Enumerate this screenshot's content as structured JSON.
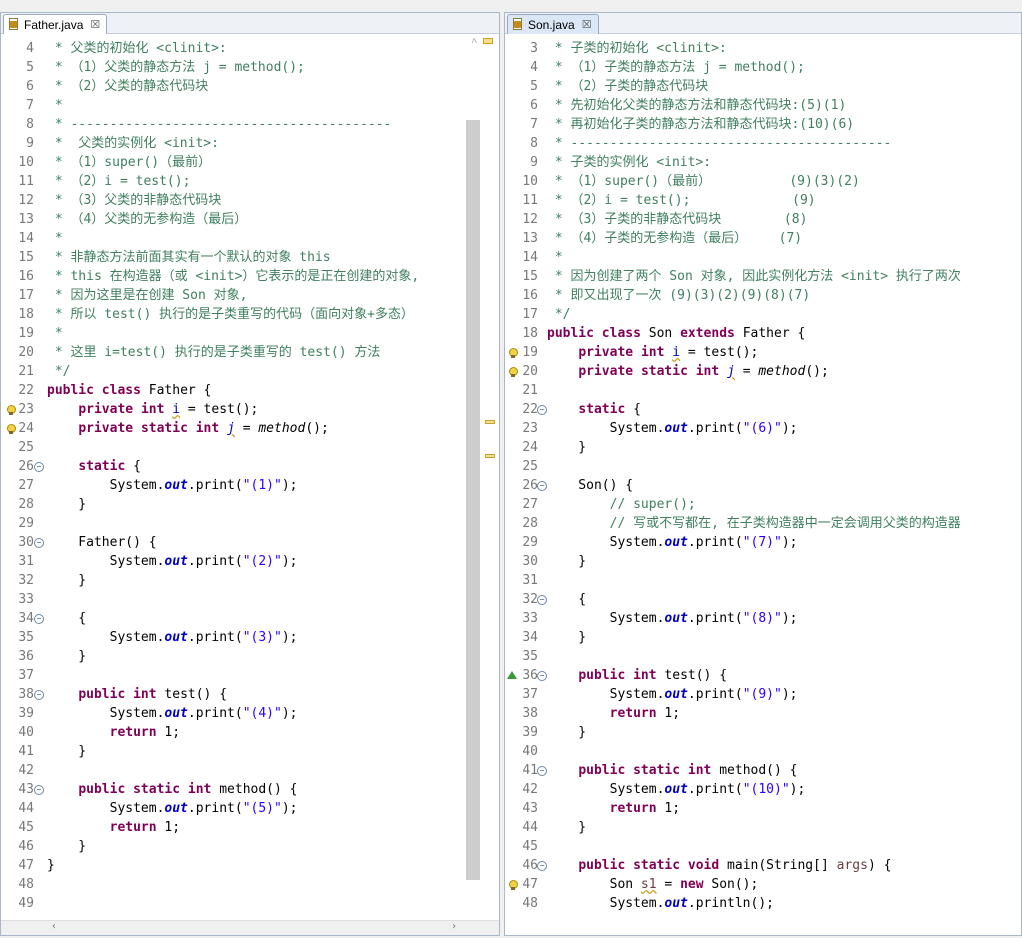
{
  "left": {
    "tab_label": "Father.java",
    "close_glyph": "☒",
    "lines": [
      {
        "n": "4",
        "html": "<span class='cmt'> * 父类的初始化 &lt;clinit&gt;:</span>"
      },
      {
        "n": "5",
        "html": "<span class='cmt'> * （1）父类的静态方法 j = method();</span>"
      },
      {
        "n": "6",
        "html": "<span class='cmt'> * （2）父类的静态代码块</span>"
      },
      {
        "n": "7",
        "html": "<span class='cmt'> *</span>"
      },
      {
        "n": "8",
        "html": "<span class='cmt'> * -----------------------------------------</span>"
      },
      {
        "n": "9",
        "html": "<span class='cmt'> *  父类的实例化 &lt;init&gt;:</span>"
      },
      {
        "n": "10",
        "html": "<span class='cmt'> * （1）super()（最前）</span>"
      },
      {
        "n": "11",
        "html": "<span class='cmt'> * （2）i = test();</span>"
      },
      {
        "n": "12",
        "html": "<span class='cmt'> * （3）父类的非静态代码块</span>"
      },
      {
        "n": "13",
        "html": "<span class='cmt'> * （4）父类的无参构造（最后）</span>"
      },
      {
        "n": "14",
        "html": "<span class='cmt'> *</span>"
      },
      {
        "n": "15",
        "html": "<span class='cmt'> * 非静态方法前面其实有一个默认的对象 this</span>"
      },
      {
        "n": "16",
        "html": "<span class='cmt'> * this 在构造器（或 &lt;init&gt;）它表示的是正在创建的对象,</span>"
      },
      {
        "n": "17",
        "html": "<span class='cmt'> * 因为这里是在创建 Son 对象,</span>"
      },
      {
        "n": "18",
        "html": "<span class='cmt'> * 所以 test() 执行的是子类重写的代码（面向对象+多态）</span>"
      },
      {
        "n": "19",
        "html": "<span class='cmt'> *</span>"
      },
      {
        "n": "20",
        "html": "<span class='cmt'> * 这里 i=test() 执行的是子类重写的 test() 方法</span>"
      },
      {
        "n": "21",
        "html": "<span class='cmt'> */</span>"
      },
      {
        "n": "22",
        "html": "<span class='kw'>public</span> <span class='kw'>class</span> Father {"
      },
      {
        "n": "23",
        "marker": "warn",
        "html": "    <span class='kw'>private</span> <span class='kw'>int</span> <span class='fld squiggle'>i</span> = test();"
      },
      {
        "n": "24",
        "marker": "warn",
        "html": "    <span class='kw'>private</span> <span class='kw'>static</span> <span class='kw'>int</span> <span class='fld squiggle' style='font-style:italic'>j</span> = <span class='smeth'>method</span>();"
      },
      {
        "n": "25",
        "html": ""
      },
      {
        "n": "26",
        "fold": true,
        "html": "    <span class='kw'>static</span> {"
      },
      {
        "n": "27",
        "html": "        System.<span class='sfld'>out</span>.print(<span class='str'>\"(1)\"</span>);"
      },
      {
        "n": "28",
        "html": "    }"
      },
      {
        "n": "29",
        "html": ""
      },
      {
        "n": "30",
        "fold": true,
        "html": "    Father() {"
      },
      {
        "n": "31",
        "html": "        System.<span class='sfld'>out</span>.print(<span class='str'>\"(2)\"</span>);"
      },
      {
        "n": "32",
        "html": "    }"
      },
      {
        "n": "33",
        "html": ""
      },
      {
        "n": "34",
        "fold": true,
        "html": "    {"
      },
      {
        "n": "35",
        "html": "        System.<span class='sfld'>out</span>.print(<span class='str'>\"(3)\"</span>);"
      },
      {
        "n": "36",
        "html": "    }"
      },
      {
        "n": "37",
        "html": ""
      },
      {
        "n": "38",
        "fold": true,
        "html": "    <span class='kw'>public</span> <span class='kw'>int</span> test() {"
      },
      {
        "n": "39",
        "html": "        System.<span class='sfld'>out</span>.print(<span class='str'>\"(4)\"</span>);"
      },
      {
        "n": "40",
        "html": "        <span class='kw'>return</span> 1;"
      },
      {
        "n": "41",
        "html": "    }"
      },
      {
        "n": "42",
        "html": ""
      },
      {
        "n": "43",
        "fold": true,
        "html": "    <span class='kw'>public</span> <span class='kw'>static</span> <span class='kw'>int</span> method() {"
      },
      {
        "n": "44",
        "html": "        System.<span class='sfld'>out</span>.print(<span class='str'>\"(5)\"</span>);"
      },
      {
        "n": "45",
        "html": "        <span class='kw'>return</span> 1;"
      },
      {
        "n": "46",
        "html": "    }"
      },
      {
        "n": "47",
        "html": "}"
      },
      {
        "n": "48",
        "html": ""
      },
      {
        "n": "49",
        "html": ""
      }
    ]
  },
  "right": {
    "tab_label": "Son.java",
    "close_glyph": "☒",
    "lines": [
      {
        "n": "3",
        "html": "<span class='cmt'> * 子类的初始化 &lt;clinit&gt;:</span>"
      },
      {
        "n": "4",
        "html": "<span class='cmt'> * （1）子类的静态方法 j = method();</span>"
      },
      {
        "n": "5",
        "html": "<span class='cmt'> * （2）子类的静态代码块</span>"
      },
      {
        "n": "6",
        "html": "<span class='cmt'> * 先初始化父类的静态方法和静态代码块:(5)(1)</span>"
      },
      {
        "n": "7",
        "html": "<span class='cmt'> * 再初始化子类的静态方法和静态代码块:(10)(6)</span>"
      },
      {
        "n": "8",
        "html": "<span class='cmt'> * -----------------------------------------</span>"
      },
      {
        "n": "9",
        "html": "<span class='cmt'> * 子类的实例化 &lt;init&gt;:</span>"
      },
      {
        "n": "10",
        "html": "<span class='cmt'> * （1）super()（最前）          (9)(3)(2)</span>"
      },
      {
        "n": "11",
        "html": "<span class='cmt'> * （2）i = test();             (9)</span>"
      },
      {
        "n": "12",
        "html": "<span class='cmt'> * （3）子类的非静态代码块        (8)</span>"
      },
      {
        "n": "13",
        "html": "<span class='cmt'> * （4）子类的无参构造（最后）    (7)</span>"
      },
      {
        "n": "14",
        "html": "<span class='cmt'> *</span>"
      },
      {
        "n": "15",
        "html": "<span class='cmt'> * 因为创建了两个 Son 对象, 因此实例化方法 &lt;init&gt; 执行了两次</span>"
      },
      {
        "n": "16",
        "html": "<span class='cmt'> * 即又出现了一次 (9)(3)(2)(9)(8)(7)</span>"
      },
      {
        "n": "17",
        "html": "<span class='cmt'> */</span>"
      },
      {
        "n": "18",
        "html": "<span class='kw'>public</span> <span class='kw'>class</span> Son <span class='kw'>extends</span> Father {"
      },
      {
        "n": "19",
        "marker": "warn",
        "html": "    <span class='kw'>private</span> <span class='kw'>int</span> <span class='fld squiggle'>i</span> = test();"
      },
      {
        "n": "20",
        "marker": "warn",
        "html": "    <span class='kw'>private</span> <span class='kw'>static</span> <span class='kw'>int</span> <span class='fld squiggle' style='font-style:italic'>j</span> = <span class='smeth'>method</span>();"
      },
      {
        "n": "21",
        "html": ""
      },
      {
        "n": "22",
        "fold": true,
        "html": "    <span class='kw'>static</span> {"
      },
      {
        "n": "23",
        "html": "        System.<span class='sfld'>out</span>.print(<span class='str'>\"(6)\"</span>);"
      },
      {
        "n": "24",
        "html": "    }"
      },
      {
        "n": "25",
        "html": ""
      },
      {
        "n": "26",
        "fold": true,
        "html": "    Son() {"
      },
      {
        "n": "27",
        "html": "        <span class='cmt'>// super();</span>"
      },
      {
        "n": "28",
        "html": "        <span class='cmt'>// 写或不写都在, 在子类构造器中一定会调用父类的构造器</span>"
      },
      {
        "n": "29",
        "html": "        System.<span class='sfld'>out</span>.print(<span class='str'>\"(7)\"</span>);"
      },
      {
        "n": "30",
        "html": "    }"
      },
      {
        "n": "31",
        "html": ""
      },
      {
        "n": "32",
        "fold": true,
        "html": "    {"
      },
      {
        "n": "33",
        "html": "        System.<span class='sfld'>out</span>.print(<span class='str'>\"(8)\"</span>);"
      },
      {
        "n": "34",
        "html": "    }"
      },
      {
        "n": "35",
        "html": ""
      },
      {
        "n": "36",
        "marker": "override",
        "fold": true,
        "html": "    <span class='kw'>public</span> <span class='kw'>int</span> test() {"
      },
      {
        "n": "37",
        "html": "        System.<span class='sfld'>out</span>.print(<span class='str'>\"(9)\"</span>);"
      },
      {
        "n": "38",
        "html": "        <span class='kw'>return</span> 1;"
      },
      {
        "n": "39",
        "html": "    }"
      },
      {
        "n": "40",
        "html": ""
      },
      {
        "n": "41",
        "fold": true,
        "html": "    <span class='kw'>public</span> <span class='kw'>static</span> <span class='kw'>int</span> method() {"
      },
      {
        "n": "42",
        "html": "        System.<span class='sfld'>out</span>.print(<span class='str'>\"(10)\"</span>);"
      },
      {
        "n": "43",
        "html": "        <span class='kw'>return</span> 1;"
      },
      {
        "n": "44",
        "html": "    }"
      },
      {
        "n": "45",
        "html": ""
      },
      {
        "n": "46",
        "fold": true,
        "html": "    <span class='kw'>public</span> <span class='kw'>static</span> <span class='kw'>void</span> main(String[] <span style='color:#6a3e3e'>args</span>) {"
      },
      {
        "n": "47",
        "marker": "warn",
        "html": "        Son <span class='squiggle' style='color:#6a3e3e'>s1</span> = <span class='kw'>new</span> Son();"
      },
      {
        "n": "48",
        "html": "        System.<span class='sfld'>out</span>.println();"
      }
    ]
  },
  "colors": {
    "comment": "#3f7f5f",
    "keyword": "#7f0055",
    "string": "#2a00ff",
    "field": "#0000c0"
  }
}
